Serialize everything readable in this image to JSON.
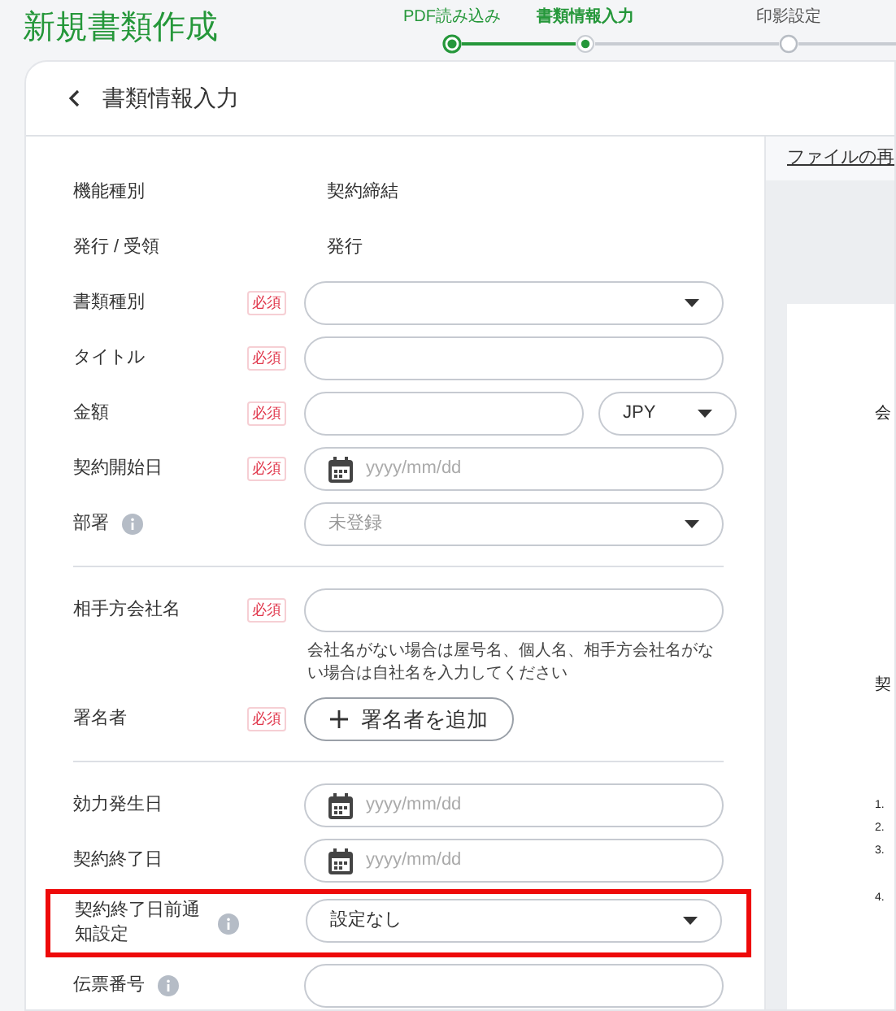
{
  "page_title": "新規書類作成",
  "steps": [
    {
      "label": "PDF読み込み",
      "kind": "done"
    },
    {
      "label": "書類情報入力",
      "kind": "current"
    },
    {
      "label": "印影設定",
      "kind": "upcoming"
    }
  ],
  "panel": {
    "title": "書類情報入力"
  },
  "sections": [
    {
      "fields": [
        {
          "label": "機能種別",
          "kind": "static",
          "value": "契約締結",
          "required": false,
          "info": false
        },
        {
          "label": "発行 / 受領",
          "kind": "static",
          "value": "発行",
          "required": false,
          "info": false
        },
        {
          "label": "書類種別",
          "kind": "select",
          "required": true,
          "info": false,
          "required_text": "必須"
        },
        {
          "label": "タイトル",
          "kind": "text",
          "required": true,
          "info": false,
          "required_text": "必須"
        },
        {
          "label": "金額",
          "kind": "money",
          "currency": "JPY",
          "required": true,
          "info": false,
          "required_text": "必須"
        },
        {
          "label": "契約開始日",
          "kind": "date",
          "placeholder": "yyyy/mm/dd",
          "required": true,
          "info": false,
          "required_text": "必須"
        },
        {
          "label": "部署",
          "kind": "select",
          "placeholder": "未登録",
          "required": false,
          "info": true
        }
      ]
    },
    {
      "fields": [
        {
          "label": "相手方会社名",
          "kind": "text",
          "required": true,
          "info": false,
          "required_text": "必須",
          "hint": "会社名がない場合は屋号名、個人名、相手方会社名がない場合は自社名を入力してください"
        },
        {
          "label": "署名者",
          "kind": "add_button",
          "button": "署名者を追加",
          "required": true,
          "info": false,
          "required_text": "必須"
        }
      ]
    },
    {
      "fields": [
        {
          "label": "効力発生日",
          "kind": "date",
          "placeholder": "yyyy/mm/dd",
          "required": false,
          "info": false
        },
        {
          "label": "契約終了日",
          "kind": "date",
          "placeholder": "yyyy/mm/dd",
          "required": false,
          "info": false
        },
        {
          "label": "契約終了日前通知設定",
          "kind": "select",
          "value": "設定なし",
          "required": false,
          "info": true,
          "highlighted": true
        },
        {
          "label": "伝票番号",
          "kind": "text",
          "required": false,
          "info": true
        }
      ]
    }
  ],
  "preview": {
    "link": "ファイルの再",
    "page_marks": [
      "会",
      "契"
    ],
    "list_marks": [
      "1.",
      "2.",
      "3.",
      "4."
    ]
  }
}
